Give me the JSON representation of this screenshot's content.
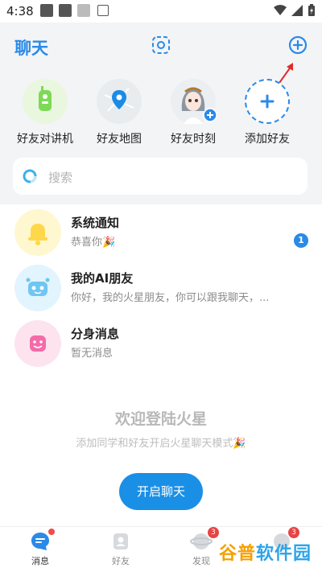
{
  "status_bar": {
    "time": "4:38"
  },
  "header": {
    "title": "聊天"
  },
  "quick_actions": [
    {
      "label": "好友对讲机",
      "icon": "walkie-talkie-icon"
    },
    {
      "label": "好友地图",
      "icon": "map-pin-icon"
    },
    {
      "label": "好友时刻",
      "icon": "avatar-moment-icon"
    },
    {
      "label": "添加好友",
      "icon": "plus-icon"
    }
  ],
  "search": {
    "placeholder": "搜索"
  },
  "chats": [
    {
      "name": "系统通知",
      "preview": "恭喜你🎉",
      "badge": "1",
      "icon": "bell-icon"
    },
    {
      "name": "我的AI朋友",
      "preview": "你好，我的火星朋友，你可以跟我聊天，...",
      "icon": "robot-icon"
    },
    {
      "name": "分身消息",
      "preview": "暂无消息",
      "icon": "smiley-icon"
    }
  ],
  "empty_state": {
    "title": "欢迎登陆火星",
    "subtitle": "添加同学和好友开启火星聊天模式🎉",
    "button": "开启聊天"
  },
  "bottom_nav": [
    {
      "label": "消息",
      "active": true
    },
    {
      "label": "好友"
    },
    {
      "label": "发现",
      "count": "3"
    },
    {
      "label": "",
      "count": "3"
    }
  ],
  "watermark": {
    "part1": "谷普",
    "part2": "软件园"
  },
  "colors": {
    "accent": "#2a8ae8",
    "badge_red": "#e84444"
  }
}
